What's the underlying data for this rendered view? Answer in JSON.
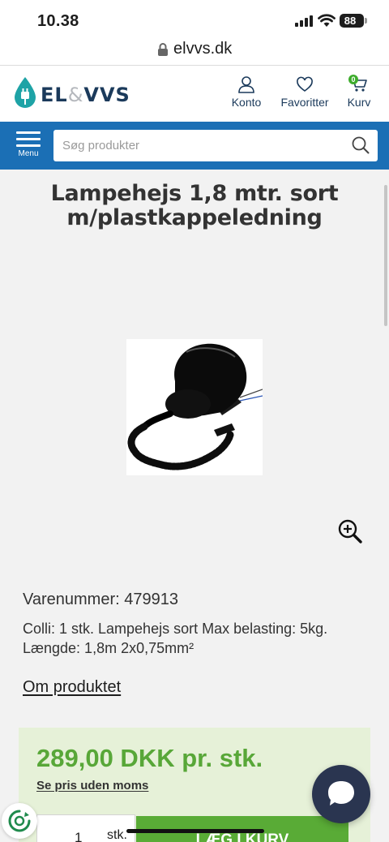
{
  "status_bar": {
    "time": "10.38",
    "battery": "88"
  },
  "browser": {
    "url": "elvvs.dk"
  },
  "header": {
    "logo_text_left": "EL",
    "logo_amp": "&",
    "logo_text_right": "VVS",
    "account_label": "Konto",
    "favorites_label": "Favoritter",
    "cart_label": "Kurv",
    "cart_count": "0"
  },
  "nav": {
    "menu_label": "Menu",
    "search_placeholder": "Søg produkter",
    "search_value": ""
  },
  "product": {
    "title": "Lampehejs 1,8 mtr. sort m/plastkappeledning",
    "sku_line": "Varenummer: 479913",
    "description": "Colli: 1 stk. Lampehejs sort Max belasting: 5kg. Længde: 1,8m 2x0,75mm²",
    "about_link": "Om produktet",
    "price": "289,00 DKK pr. stk.",
    "price_ex_vat_link": "Se pris uden moms",
    "quantity": "1",
    "quantity_unit": "stk.",
    "add_to_cart_label": "LÆG I KURV"
  },
  "colors": {
    "brand_blue": "#1b6fb5",
    "brand_navy": "#1b3a5b",
    "price_green": "#58a738",
    "button_green": "#59ab36",
    "price_panel": "#e6f1d8"
  },
  "icons": [
    "lock-icon",
    "user-icon",
    "heart-icon",
    "cart-icon",
    "hamburger-icon",
    "search-icon",
    "zoom-in-icon",
    "chat-icon",
    "cookie-icon"
  ]
}
